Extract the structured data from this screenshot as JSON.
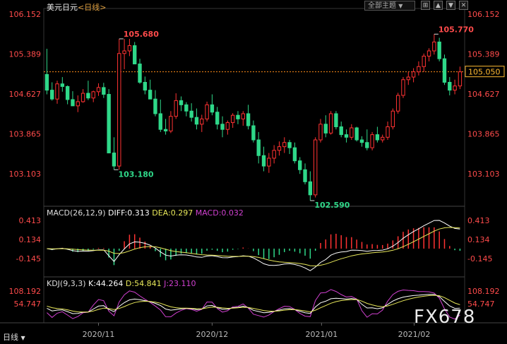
{
  "header": {
    "title": "美元日元",
    "period_label": "<日线>",
    "theme_button": "全部主题",
    "expand_icon": "expand-icon",
    "up_icon": "arrow-up-icon",
    "down_icon": "arrow-down-icon",
    "close_icon": "close-icon"
  },
  "footer": {
    "period_tab": "日线"
  },
  "watermark": "FX678",
  "colors": {
    "up": "#ff3232",
    "down": "#2fd889",
    "axis_label": "#ff4b4b",
    "diff_line": "#ffffff",
    "dea_line": "#e8e85a",
    "macd_text": "#d040d0",
    "k_line": "#ffffff",
    "d_line": "#e8e85a",
    "j_line": "#d040d0",
    "current_price_box": "#ffbb33",
    "grid": "#333333"
  },
  "macd": {
    "label": "MACD(26,12,9)",
    "diff": "DIFF:0.313",
    "dea": "DEA:0.297",
    "macd": "MACD:0.032",
    "ticks": [
      "0.413",
      "0.134",
      "-0.145"
    ]
  },
  "kdj": {
    "label": "KDJ(9,3,3)",
    "k": "K:44.264",
    "d": "D:54.841",
    "j": "J:23.110",
    "ticks": [
      "108.192",
      "54.747"
    ]
  },
  "chart_data": {
    "type": "candlestick",
    "title": "美元日元 <日线>",
    "x_ticks": [
      "2020/11",
      "2020/12",
      "2021/01",
      "2021/02"
    ],
    "y_ticks": [
      "106.152",
      "105.389",
      "104.627",
      "103.865",
      "103.103"
    ],
    "y_range": [
      102.59,
      106.152
    ],
    "current_price": "105.050",
    "current_price_value": 105.05,
    "annotations": [
      {
        "label": "105.680",
        "value": 105.68
      },
      {
        "label": "103.180",
        "value": 103.18
      },
      {
        "label": "102.590",
        "value": 102.59
      },
      {
        "label": "105.770",
        "value": 105.77
      }
    ],
    "candles": [
      [
        105.0,
        105.49,
        104.62,
        104.7
      ],
      [
        104.7,
        104.85,
        104.5,
        104.53
      ],
      [
        104.53,
        104.88,
        104.44,
        104.82
      ],
      [
        104.82,
        104.95,
        104.67,
        104.77
      ],
      [
        104.77,
        104.79,
        104.43,
        104.52
      ],
      [
        104.52,
        104.68,
        104.43,
        104.4
      ],
      [
        104.4,
        104.6,
        104.28,
        104.48
      ],
      [
        104.48,
        104.72,
        104.46,
        104.64
      ],
      [
        104.64,
        104.88,
        104.51,
        104.55
      ],
      [
        104.55,
        104.69,
        104.47,
        104.67
      ],
      [
        104.67,
        104.83,
        104.59,
        104.75
      ],
      [
        104.75,
        104.84,
        104.55,
        104.62
      ],
      [
        104.62,
        104.72,
        103.5,
        103.5
      ],
      [
        103.5,
        103.8,
        103.18,
        103.25
      ],
      [
        103.25,
        105.68,
        103.18,
        105.4
      ],
      [
        105.4,
        105.68,
        105.1,
        105.45
      ],
      [
        105.45,
        105.68,
        105.35,
        105.55
      ],
      [
        105.55,
        105.62,
        105.2,
        105.2
      ],
      [
        105.2,
        105.3,
        104.82,
        104.85
      ],
      [
        104.85,
        104.96,
        104.62,
        104.7
      ],
      [
        104.7,
        104.9,
        104.55,
        104.53
      ],
      [
        104.53,
        104.7,
        104.2,
        104.25
      ],
      [
        104.25,
        104.52,
        103.9,
        103.95
      ],
      [
        103.95,
        104.15,
        103.85,
        103.92
      ],
      [
        103.92,
        104.3,
        103.88,
        104.2
      ],
      [
        104.2,
        104.64,
        104.15,
        104.5
      ],
      [
        104.5,
        104.58,
        104.3,
        104.42
      ],
      [
        104.42,
        104.47,
        104.2,
        104.3
      ],
      [
        104.3,
        104.45,
        104.1,
        104.18
      ],
      [
        104.18,
        104.35,
        103.95,
        104.05
      ],
      [
        104.05,
        104.23,
        103.9,
        104.15
      ],
      [
        104.15,
        104.48,
        104.1,
        104.42
      ],
      [
        104.42,
        104.62,
        104.22,
        104.28
      ],
      [
        104.28,
        104.38,
        103.95,
        104.05
      ],
      [
        104.05,
        104.2,
        103.8,
        103.95
      ],
      [
        103.95,
        104.12,
        103.85,
        104.08
      ],
      [
        104.08,
        104.26,
        103.98,
        104.22
      ],
      [
        104.22,
        104.3,
        104.05,
        104.15
      ],
      [
        104.15,
        104.3,
        104.02,
        104.25
      ],
      [
        104.25,
        104.42,
        103.95,
        104.02
      ],
      [
        104.02,
        104.12,
        103.7,
        103.75
      ],
      [
        103.75,
        103.9,
        103.3,
        103.45
      ],
      [
        103.45,
        103.62,
        103.15,
        103.25
      ],
      [
        103.25,
        103.5,
        103.12,
        103.4
      ],
      [
        103.4,
        103.65,
        103.3,
        103.55
      ],
      [
        103.55,
        103.72,
        103.45,
        103.62
      ],
      [
        103.62,
        103.8,
        103.5,
        103.7
      ],
      [
        103.7,
        103.75,
        103.48,
        103.6
      ],
      [
        103.6,
        103.7,
        103.3,
        103.35
      ],
      [
        103.35,
        103.42,
        103.1,
        103.18
      ],
      [
        103.18,
        103.3,
        102.9,
        102.95
      ],
      [
        102.95,
        103.15,
        102.59,
        102.7
      ],
      [
        102.7,
        103.8,
        102.65,
        103.75
      ],
      [
        103.75,
        104.15,
        103.7,
        104.05
      ],
      [
        104.05,
        104.22,
        103.8,
        103.88
      ],
      [
        103.88,
        104.3,
        103.85,
        104.25
      ],
      [
        104.25,
        104.3,
        103.95,
        104.0
      ],
      [
        104.0,
        104.1,
        103.8,
        103.85
      ],
      [
        103.85,
        103.95,
        103.7,
        103.8
      ],
      [
        103.8,
        104.05,
        103.75,
        103.98
      ],
      [
        103.98,
        104.0,
        103.72,
        103.75
      ],
      [
        103.75,
        103.82,
        103.62,
        103.7
      ],
      [
        103.7,
        103.95,
        103.55,
        103.6
      ],
      [
        103.6,
        103.9,
        103.55,
        103.85
      ],
      [
        103.85,
        104.0,
        103.7,
        103.75
      ],
      [
        103.75,
        103.85,
        103.7,
        103.8
      ],
      [
        103.8,
        104.1,
        103.75,
        104.0
      ],
      [
        104.0,
        104.35,
        103.95,
        104.3
      ],
      [
        104.3,
        104.65,
        104.25,
        104.6
      ],
      [
        104.6,
        104.95,
        104.55,
        104.9
      ],
      [
        104.9,
        105.05,
        104.8,
        104.95
      ],
      [
        104.95,
        105.12,
        104.85,
        105.05
      ],
      [
        105.05,
        105.25,
        104.98,
        105.15
      ],
      [
        105.15,
        105.4,
        105.05,
        105.35
      ],
      [
        105.35,
        105.5,
        105.25,
        105.45
      ],
      [
        105.45,
        105.77,
        105.38,
        105.62
      ],
      [
        105.62,
        105.7,
        105.25,
        105.3
      ],
      [
        105.3,
        105.38,
        104.8,
        104.85
      ],
      [
        104.85,
        104.95,
        104.6,
        104.7
      ],
      [
        104.7,
        104.9,
        104.62,
        104.78
      ],
      [
        104.78,
        105.15,
        104.72,
        105.05
      ]
    ]
  }
}
